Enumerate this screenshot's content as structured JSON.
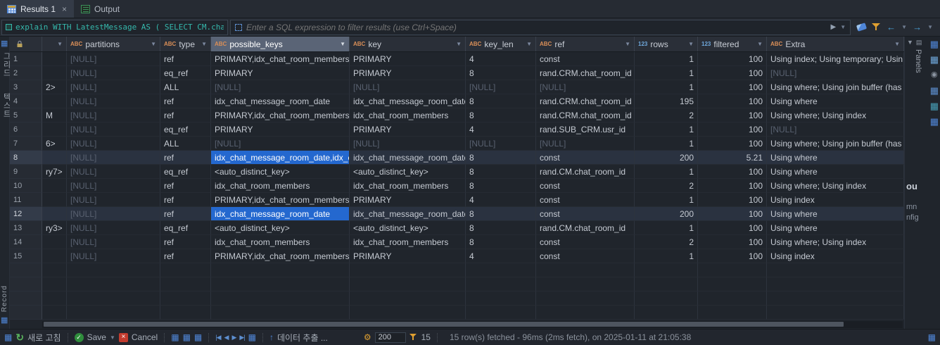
{
  "tabs": [
    {
      "label": "Results 1",
      "close": "×"
    },
    {
      "label": "Output"
    }
  ],
  "filter_bar": {
    "sql_text": "explain WITH LatestMessage AS ( SELECT CM.chat_room_",
    "placeholder": "Enter a SQL expression to filter results (use Ctrl+Space)"
  },
  "left_tabs": {
    "grid": "그리드",
    "text": "텍스트",
    "record": "Record"
  },
  "grid": {
    "columns": [
      {
        "type": "",
        "label": ""
      },
      {
        "type": "ABC",
        "label": "partitions"
      },
      {
        "type": "ABC",
        "label": "type"
      },
      {
        "type": "ABC",
        "label": "possible_keys",
        "selected": true
      },
      {
        "type": "ABC",
        "label": "key"
      },
      {
        "type": "ABC",
        "label": "key_len"
      },
      {
        "type": "ABC",
        "label": "ref"
      },
      {
        "type": "123",
        "label": "rows"
      },
      {
        "type": "123",
        "label": "filtered"
      },
      {
        "type": "ABC",
        "label": "Extra"
      }
    ],
    "rows": [
      [
        "1",
        "",
        "[NULL]",
        "ref",
        "PRIMARY,idx_chat_room_members",
        "PRIMARY",
        "4",
        "const",
        "1",
        "100",
        "Using index; Using temporary; Usin"
      ],
      [
        "2",
        "",
        "[NULL]",
        "eq_ref",
        "PRIMARY",
        "PRIMARY",
        "8",
        "rand.CRM.chat_room_id",
        "1",
        "100",
        "[NULL]"
      ],
      [
        "3",
        "2>",
        "[NULL]",
        "ALL",
        "[NULL]",
        "[NULL]",
        "[NULL]",
        "[NULL]",
        "1",
        "100",
        "Using where; Using join buffer (has"
      ],
      [
        "4",
        "",
        "[NULL]",
        "ref",
        "idx_chat_message_room_date",
        "idx_chat_message_room_date",
        "8",
        "rand.CRM.chat_room_id",
        "195",
        "100",
        "Using where"
      ],
      [
        "5",
        "M",
        "[NULL]",
        "ref",
        "PRIMARY,idx_chat_room_members",
        "idx_chat_room_members",
        "8",
        "rand.CRM.chat_room_id",
        "2",
        "100",
        "Using where; Using index"
      ],
      [
        "6",
        "",
        "[NULL]",
        "eq_ref",
        "PRIMARY",
        "PRIMARY",
        "4",
        "rand.SUB_CRM.usr_id",
        "1",
        "100",
        "[NULL]"
      ],
      [
        "7",
        "6>",
        "[NULL]",
        "ALL",
        "[NULL]",
        "[NULL]",
        "[NULL]",
        "[NULL]",
        "1",
        "100",
        "Using where; Using join buffer (has"
      ],
      [
        "8",
        "",
        "[NULL]",
        "ref",
        "idx_chat_message_room_date,idx_ch",
        "idx_chat_message_room_date",
        "8",
        "const",
        "200",
        "5.21",
        "Using where"
      ],
      [
        "9",
        "ry7>",
        "[NULL]",
        "eq_ref",
        "<auto_distinct_key>",
        "<auto_distinct_key>",
        "8",
        "rand.CM.chat_room_id",
        "1",
        "100",
        "Using where"
      ],
      [
        "10",
        "",
        "[NULL]",
        "ref",
        "idx_chat_room_members",
        "idx_chat_room_members",
        "8",
        "const",
        "2",
        "100",
        "Using where; Using index"
      ],
      [
        "11",
        "",
        "[NULL]",
        "ref",
        "PRIMARY,idx_chat_room_members",
        "PRIMARY",
        "4",
        "const",
        "1",
        "100",
        "Using index"
      ],
      [
        "12",
        "",
        "[NULL]",
        "ref",
        "idx_chat_message_room_date",
        "idx_chat_message_room_date",
        "8",
        "const",
        "200",
        "100",
        "Using where"
      ],
      [
        "13",
        "ry3>",
        "[NULL]",
        "eq_ref",
        "<auto_distinct_key>",
        "<auto_distinct_key>",
        "8",
        "rand.CM.chat_room_id",
        "1",
        "100",
        "Using where"
      ],
      [
        "14",
        "",
        "[NULL]",
        "ref",
        "idx_chat_room_members",
        "idx_chat_room_members",
        "8",
        "const",
        "2",
        "100",
        "Using where; Using index"
      ],
      [
        "15",
        "",
        "[NULL]",
        "ref",
        "PRIMARY,idx_chat_room_members",
        "PRIMARY",
        "4",
        "const",
        "1",
        "100",
        "Using index"
      ]
    ],
    "selected_rows": [
      8,
      12
    ],
    "selected_cells": [
      [
        8,
        4
      ],
      [
        12,
        4
      ]
    ],
    "empty_rows": 4
  },
  "right_panel": {
    "title": "Panels",
    "fragments": [
      "ou",
      "mn",
      "nfig"
    ]
  },
  "status_bar": {
    "refresh": "새로 고침",
    "save": "Save",
    "cancel": "Cancel",
    "export": "데이터 추출 ...",
    "fetch_size": "200",
    "segment_count": "15",
    "message": "15 row(s) fetched - 96ms (2ms fetch), on 2025-01-11 at 21:05:38"
  },
  "icons": {
    "refresh": "↻",
    "check": "✓",
    "cancel": "×",
    "caret_down": "▼",
    "play": "▶",
    "nav_first": "|◀",
    "nav_prev": "◀",
    "nav_next": "▶",
    "nav_last": "▶|",
    "export_up": "↑",
    "gear": "⚙",
    "arrow_left": "←",
    "arrow_right": "→",
    "grid_glyph": "▦",
    "record": "◉",
    "mini_panel": "▤"
  },
  "colors": {
    "accent_selection": "#2468cf",
    "sql_teal": "#35b8ac",
    "save_green": "#2f8d3c",
    "cancel_red": "#c23b2e",
    "badge_string": "#d98e57",
    "badge_number": "#6fa8dc"
  }
}
